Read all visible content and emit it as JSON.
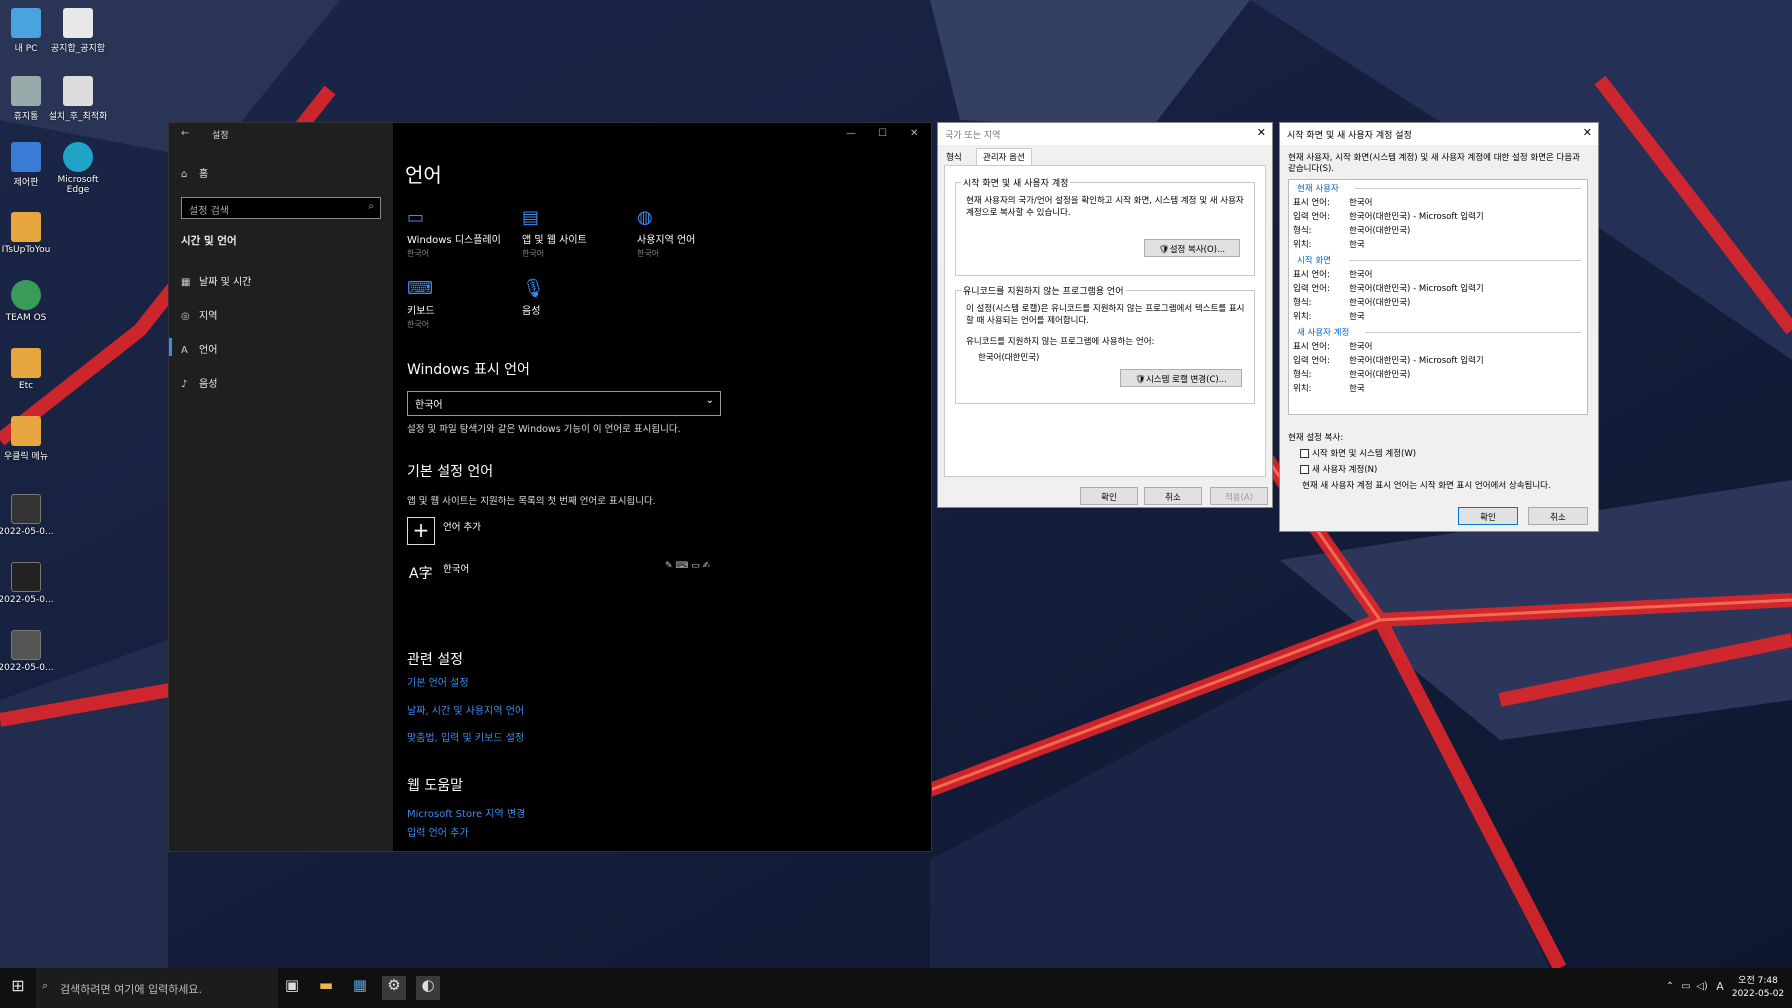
{
  "desktop": {
    "icons": [
      {
        "label": "내 PC"
      },
      {
        "label": "공지합_공지함"
      },
      {
        "label": "휴지통"
      },
      {
        "label": "설치_후_최적화"
      },
      {
        "label": "제어판"
      },
      {
        "label": "Microsoft Edge"
      },
      {
        "label": "ITsUpToYou"
      },
      {
        "label": "TEAM OS"
      },
      {
        "label": "Etc"
      },
      {
        "label": "우클릭 메뉴"
      },
      {
        "label": "2022-05-0..."
      },
      {
        "label": "2022-05-0..."
      },
      {
        "label": "2022-05-0..."
      }
    ]
  },
  "settings": {
    "title": "설정",
    "home": "홈",
    "search_placeholder": "설정 검색",
    "category": "시간 및 언어",
    "nav": [
      {
        "label": "날짜 및 시간",
        "icon": "calendar-clock-icon"
      },
      {
        "label": "지역",
        "icon": "globe-region-icon"
      },
      {
        "label": "언어",
        "icon": "language-icon"
      },
      {
        "label": "음성",
        "icon": "microphone-icon"
      }
    ],
    "page_title": "언어",
    "tiles": [
      {
        "label": "Windows 디스플레이",
        "sub": "한국어",
        "icon": "monitor-icon"
      },
      {
        "label": "앱 및 웹 사이트",
        "sub": "한국어",
        "icon": "browser-window-icon"
      },
      {
        "label": "사용지역 언어",
        "sub": "한국어",
        "icon": "globe-settings-icon"
      },
      {
        "label": "키보드",
        "sub": "한국어",
        "icon": "keyboard-icon"
      },
      {
        "label": "음성",
        "sub": "",
        "icon": "microphone-icon"
      }
    ],
    "display_language_heading": "Windows 표시 언어",
    "display_language_value": "한국어",
    "display_language_desc": "설정 및 파일 탐색기와 같은 Windows 기능이 이 언어로 표시됩니다.",
    "preferred_heading": "기본 설정 언어",
    "preferred_desc": "앱 및 웹 사이트는 지원하는 목록의 첫 번째 언어로 표시됩니다.",
    "add_language": "언어 추가",
    "language_item": "한국어",
    "related_heading": "관련 설정",
    "related_links": [
      "기본 언어 설정",
      "날짜, 시간 및 사용지역 언어",
      "맞춤법, 입력 및 키보드 설정"
    ],
    "web_help_heading": "웹 도움말",
    "web_help_links": [
      "Microsoft Store 지역 변경",
      "입력 언어 추가"
    ]
  },
  "region_dialog": {
    "title": "국가 또는 지역",
    "tabs": [
      "형식",
      "관리자 옵션"
    ],
    "group1_title": "시작 화면 및 새 사용자 계정",
    "group1_text": "현재 사용자의 국가/언어 설정을 확인하고 시작 화면, 시스템 계정 및 새 사용자 계정으로 복사할 수 있습니다.",
    "copy_settings_button": "설정 복사(O)...",
    "group2_title": "유니코드를 지원하지 않는 프로그램용 언어",
    "group2_text": "이 설정(시스템 로캘)은 유니코드를 지원하지 않는 프로그램에서 텍스트를 표시할 때 사용되는 언어를 제어합니다.",
    "group2_label": "유니코드를 지원하지 않는 프로그램에 사용하는 언어:",
    "group2_value": "한국어(대한민국)",
    "change_locale_button": "시스템 로캘 변경(C)...",
    "ok": "확인",
    "cancel": "취소",
    "apply": "적용(A)"
  },
  "welcome_dialog": {
    "title": "시작 화면 및 새 사용자 계정 설정",
    "intro": "현재 사용자, 시작 화면(시스템 계정) 및 새 사용자 계정에 대한 설정 화면은 다음과 같습니다(S).",
    "sections": [
      {
        "title": "현재 사용자",
        "rows": [
          {
            "k": "표시 언어:",
            "v": "한국어"
          },
          {
            "k": "입력 언어:",
            "v": "한국어(대한민국) - Microsoft 입력기"
          },
          {
            "k": "형식:",
            "v": "한국어(대한민국)"
          },
          {
            "k": "위치:",
            "v": "한국"
          }
        ]
      },
      {
        "title": "시작 화면",
        "rows": [
          {
            "k": "표시 언어:",
            "v": "한국어"
          },
          {
            "k": "입력 언어:",
            "v": "한국어(대한민국) - Microsoft 입력기"
          },
          {
            "k": "형식:",
            "v": "한국어(대한민국)"
          },
          {
            "k": "위치:",
            "v": "한국"
          }
        ]
      },
      {
        "title": "새 사용자 계정",
        "rows": [
          {
            "k": "표시 언어:",
            "v": "한국어"
          },
          {
            "k": "입력 언어:",
            "v": "한국어(대한민국) - Microsoft 입력기"
          },
          {
            "k": "형식:",
            "v": "한국어(대한민국)"
          },
          {
            "k": "위치:",
            "v": "한국"
          }
        ]
      }
    ],
    "copy_label": "현재 설정 복사:",
    "check1": "시작 화면 및 시스템 계정(W)",
    "check2": "새 사용자 계정(N)",
    "note": "현재 새 사용자 계정 표시 언어는 시작 화면 표시 언어에서 상속됩니다.",
    "ok": "확인",
    "cancel": "취소"
  },
  "taskbar": {
    "search_placeholder": "검색하려면 여기에 입력하세요.",
    "ime": "A",
    "time": "오전 7:48",
    "date": "2022-05-02"
  }
}
